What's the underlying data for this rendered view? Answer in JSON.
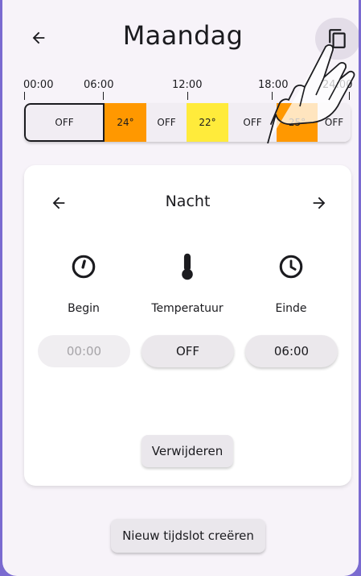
{
  "header": {
    "title": "Maandag"
  },
  "timeline": {
    "ticks": [
      "00:00",
      "06:00",
      "12:00",
      "18:00",
      "24:00"
    ],
    "segments": [
      {
        "label": "OFF",
        "color": "#f1edf3"
      },
      {
        "label": "24°",
        "color": "#ff9800"
      },
      {
        "label": "OFF",
        "color": "#f1edf3"
      },
      {
        "label": "22°",
        "color": "#ffeb3b"
      },
      {
        "label": "OFF",
        "color": "#f1edf3"
      },
      {
        "label": "25°",
        "color": "#ff9800"
      },
      {
        "label": "OFF",
        "color": "#f1edf3"
      }
    ]
  },
  "card": {
    "slot_name": "Nacht",
    "begin": {
      "label": "Begin",
      "value": "00:00"
    },
    "temperature": {
      "label": "Temperatuur",
      "value": "OFF"
    },
    "end": {
      "label": "Einde",
      "value": "06:00"
    },
    "delete_label": "Verwijderen"
  },
  "new_slot_label": "Nieuw tijdslot creëren",
  "icons": {
    "back": "arrow-left-icon",
    "copy": "copy-icon",
    "prev": "arrow-left-icon",
    "next": "arrow-right-icon",
    "begin": "timer-icon",
    "temperature": "thermometer-icon",
    "end": "clock-icon",
    "touch": "hand-pointer-icon"
  }
}
